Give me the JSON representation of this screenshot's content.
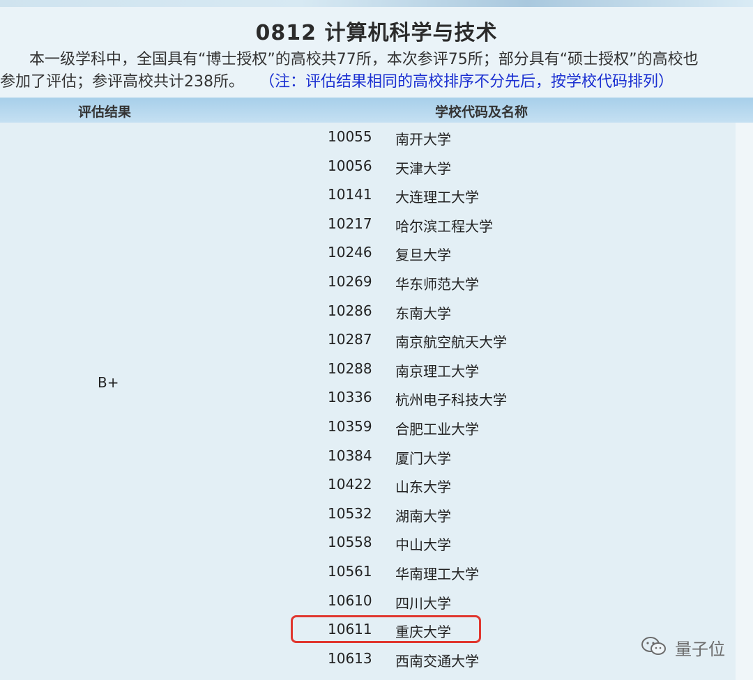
{
  "header": {
    "title": "0812 计算机科学与技术",
    "intro_line1": "本一级学科中，全国具有“博士授权”的高校共77所，本次参评75所；部分具有“硕士授权”的高校也",
    "intro_line2": "参加了评估；参评高校共计238所。",
    "note": "（注：评估结果相同的高校排序不分先后，按学校代码排列）"
  },
  "table": {
    "col_result": "评估结果",
    "col_school": "学校代码及名称",
    "grade": "B+",
    "rows": [
      {
        "code": "10055",
        "name": "南开大学"
      },
      {
        "code": "10056",
        "name": "天津大学"
      },
      {
        "code": "10141",
        "name": "大连理工大学"
      },
      {
        "code": "10217",
        "name": "哈尔滨工程大学"
      },
      {
        "code": "10246",
        "name": "复旦大学"
      },
      {
        "code": "10269",
        "name": "华东师范大学"
      },
      {
        "code": "10286",
        "name": "东南大学"
      },
      {
        "code": "10287",
        "name": "南京航空航天大学"
      },
      {
        "code": "10288",
        "name": "南京理工大学"
      },
      {
        "code": "10336",
        "name": "杭州电子科技大学"
      },
      {
        "code": "10359",
        "name": "合肥工业大学"
      },
      {
        "code": "10384",
        "name": "厦门大学"
      },
      {
        "code": "10422",
        "name": "山东大学"
      },
      {
        "code": "10532",
        "name": "湖南大学"
      },
      {
        "code": "10558",
        "name": "中山大学"
      },
      {
        "code": "10561",
        "name": "华南理工大学"
      },
      {
        "code": "10610",
        "name": "四川大学"
      },
      {
        "code": "10611",
        "name": "重庆大学"
      },
      {
        "code": "10613",
        "name": "西南交通大学"
      }
    ]
  },
  "watermark": {
    "text": "量子位",
    "icon": "wechat-icon"
  },
  "colors": {
    "note": "#1a2fd1",
    "highlight": "#e0372f",
    "header_bg": "#a7cfea"
  }
}
